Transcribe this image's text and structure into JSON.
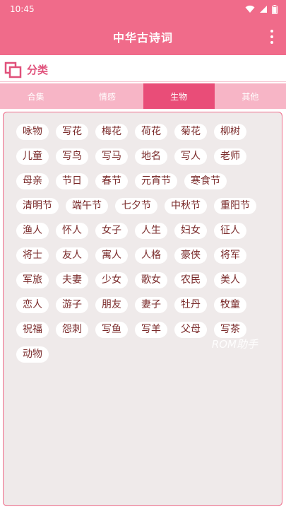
{
  "status_bar": {
    "time": "10:45"
  },
  "app_bar": {
    "title": "中华古诗词"
  },
  "section": {
    "label": "分类"
  },
  "tabs": [
    {
      "label": "合集",
      "active": false
    },
    {
      "label": "情感",
      "active": false
    },
    {
      "label": "生物",
      "active": true
    },
    {
      "label": "其他",
      "active": false
    }
  ],
  "tags": [
    "咏物",
    "写花",
    "梅花",
    "荷花",
    "菊花",
    "柳树",
    "儿童",
    "写鸟",
    "写马",
    "地名",
    "写人",
    "老师",
    "母亲",
    "节日",
    "春节",
    "元宵节",
    "寒食节",
    "清明节",
    "端午节",
    "七夕节",
    "中秋节",
    "重阳节",
    "渔人",
    "怀人",
    "女子",
    "人生",
    "妇女",
    "征人",
    "将士",
    "友人",
    "寓人",
    "人格",
    "豪侠",
    "将军",
    "军旅",
    "夫妻",
    "少女",
    "歌女",
    "农民",
    "美人",
    "恋人",
    "游子",
    "朋友",
    "妻子",
    "牡丹",
    "牧童",
    "祝福",
    "怨刺",
    "写鱼",
    "写羊",
    "父母",
    "写茶",
    "动物"
  ],
  "watermark": "ROM助手",
  "colors": {
    "primary": "#f06b8a",
    "tab_bg": "#f7b5c6",
    "tab_active": "#e94d78",
    "tag_text": "#7a2a2a",
    "content_bg": "#efeaea"
  },
  "icons": {
    "wifi": "wifi-icon",
    "signal": "signal-icon",
    "battery": "battery-icon",
    "more": "more-vert-icon",
    "category": "category-icon"
  }
}
